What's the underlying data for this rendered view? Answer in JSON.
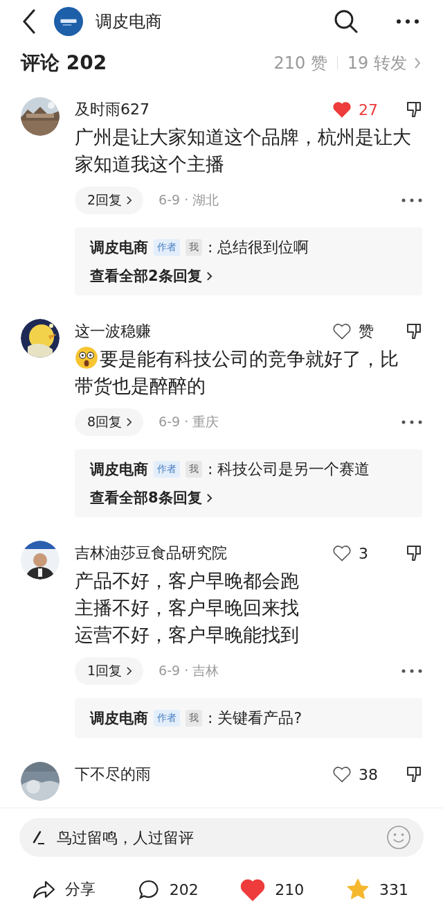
{
  "header": {
    "account_name": "调皮电商"
  },
  "summary": {
    "title": "评论 202",
    "likes": "210 赞",
    "reposts": "19 转发"
  },
  "comments": [
    {
      "name": "及时雨627",
      "liked": true,
      "like_label": "27",
      "lines": [
        "广州是让大家知道这个品牌，杭州是让大家知道我这个主播"
      ],
      "replies_button": "2回复",
      "meta": "6-9 · 湖北",
      "reply": {
        "author": "调皮电商",
        "author_badge": "作者",
        "me_badge": "我",
        "text": ": 总结很到位啊",
        "more": "查看全部2条回复"
      }
    },
    {
      "name": "这一波稳赚",
      "liked": false,
      "like_label": "赞",
      "has_emoji": true,
      "lines": [
        "要是能有科技公司的竞争就好了，比带货也是醉醉的"
      ],
      "replies_button": "8回复",
      "meta": "6-9 · 重庆",
      "reply": {
        "author": "调皮电商",
        "author_badge": "作者",
        "me_badge": "我",
        "text": ": 科技公司是另一个赛道",
        "more": "查看全部8条回复"
      }
    },
    {
      "name": "吉林油莎豆食品研究院",
      "liked": false,
      "like_label": "3",
      "lines": [
        "产品不好，客户早晚都会跑",
        "主播不好，客户早晚回来找",
        "运营不好，客户早晚能找到"
      ],
      "replies_button": "1回复",
      "meta": "6-9 · 吉林",
      "reply": {
        "author": "调皮电商",
        "author_badge": "作者",
        "me_badge": "我",
        "text": ": 关键看产品?"
      }
    },
    {
      "name": "下不尽的雨",
      "liked": false,
      "like_label": "38"
    }
  ],
  "composer": {
    "placeholder": "鸟过留鸣，人过留评"
  },
  "actions": [
    {
      "kind": "share",
      "label": "分享",
      "active": false
    },
    {
      "kind": "comment",
      "label": "202",
      "active": false
    },
    {
      "kind": "like",
      "label": "210",
      "active": true
    },
    {
      "kind": "favorite",
      "label": "331",
      "active": true
    }
  ]
}
